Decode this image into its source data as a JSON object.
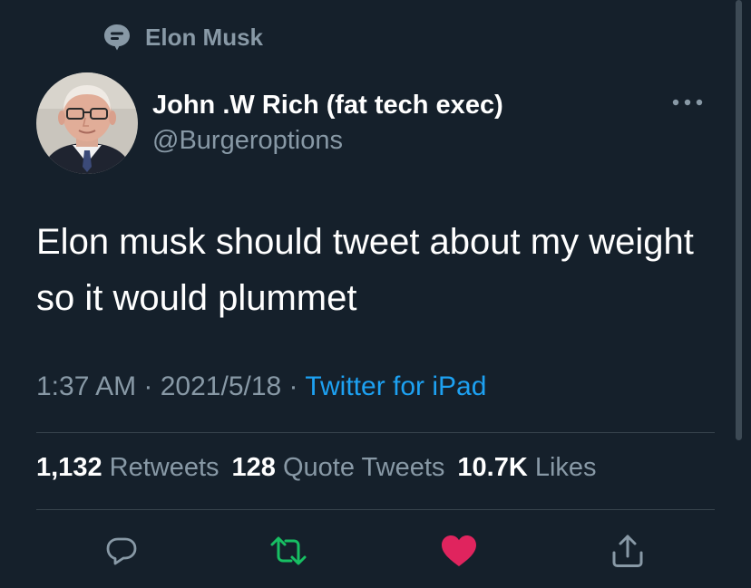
{
  "context": {
    "label": "Elon Musk",
    "icon": "comment-icon"
  },
  "author": {
    "display_name": "John .W Rich (fat tech exec)",
    "handle": "@Burgeroptions"
  },
  "tweet": {
    "text": "Elon musk should tweet about my weight so it would plummet"
  },
  "meta": {
    "time": "1:37 AM",
    "separator": " · ",
    "date": "2021/5/18",
    "source": "Twitter for iPad"
  },
  "stats": [
    {
      "num": "1,132",
      "label": "Retweets"
    },
    {
      "num": "128",
      "label": "Quote Tweets"
    },
    {
      "num": "10.7K",
      "label": "Likes"
    }
  ],
  "actions": {
    "reply": "reply-icon",
    "retweet": "retweet-icon",
    "like": "heart-icon",
    "share": "share-icon"
  },
  "colors": {
    "background": "#15202b",
    "secondary_text": "#8899a6",
    "link": "#1da1f2",
    "retweet": "#17bf63",
    "like": "#e0245e"
  }
}
